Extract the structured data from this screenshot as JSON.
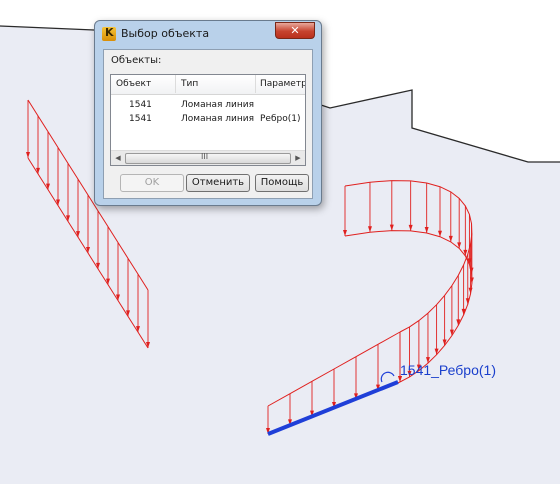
{
  "viewport": {
    "label": "1541_Ребро(1)",
    "colors": {
      "background": "#f0f1f5",
      "surface": "#e7e9f2",
      "edge": "#2a2a2a",
      "load": "#e0201e",
      "selection": "#1f3fd8",
      "label": "#1a3fcc"
    }
  },
  "dialog": {
    "title": "Выбор объекта",
    "icon": "app-logo-icon",
    "icon_glyph": "K",
    "close_glyph": "✕",
    "objects_label": "Объекты:",
    "columns": [
      "Объект",
      "Тип",
      "Параметр."
    ],
    "rows": [
      {
        "object": "1541",
        "type": "Ломаная линия",
        "param": ""
      },
      {
        "object": "1541",
        "type": "Ломаная линия",
        "param": "Ребро(1)"
      }
    ],
    "scrollbar": {
      "left_glyph": "◀",
      "right_glyph": "▶",
      "grip_glyph": "III"
    },
    "buttons": {
      "ok": "OK",
      "cancel": "Отменить",
      "help": "Помощь"
    }
  }
}
